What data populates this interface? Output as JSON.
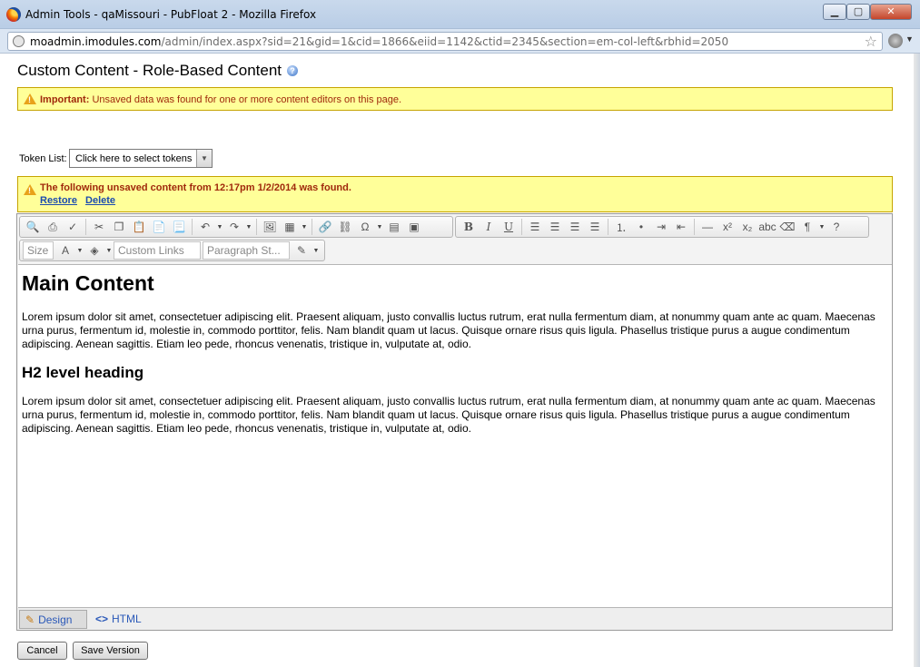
{
  "window": {
    "title": "Admin Tools - qaMissouri - PubFloat 2 - Mozilla Firefox",
    "min_label": "▁",
    "max_label": "▢",
    "close_label": "✕"
  },
  "browser": {
    "url_host": "moadmin.imodules.com",
    "url_path": "/admin/index.aspx?sid=21&gid=1&cid=1866&eiid=1142&ctid=2345&section=em-col-left&rbhid=2050"
  },
  "page": {
    "title": "Custom Content - Role-Based Content",
    "help_label": "?"
  },
  "alert_unsaved": {
    "prefix": "Important:",
    "message": "Unsaved data was found for one or more content editors on this page."
  },
  "token_list": {
    "label": "Token List:",
    "value": "Click here to select tokens"
  },
  "alert_restore": {
    "message": "The following unsaved content from 12:17pm 1/2/2014 was found.",
    "restore_label": "Restore",
    "delete_label": "Delete"
  },
  "toolbar": {
    "size_label": "Size",
    "custom_links_label": "Custom Links",
    "paragraph_label": "Paragraph St...",
    "bold": "B",
    "italic": "I",
    "underline": "U",
    "omega": "Ω"
  },
  "content": {
    "heading1": "Main Content",
    "paragraph1": "Lorem ipsum dolor sit amet, consectetuer adipiscing elit. Praesent aliquam, justo convallis luctus rutrum, erat nulla fermentum diam, at nonummy quam ante ac quam. Maecenas urna purus, fermentum id, molestie in, commodo porttitor, felis. Nam blandit quam ut lacus. Quisque ornare risus quis ligula. Phasellus tristique purus a augue condimentum adipiscing. Aenean sagittis. Etiam leo pede, rhoncus venenatis, tristique in, vulputate at, odio.",
    "heading2": "H2 level heading",
    "paragraph2": "Lorem ipsum dolor sit amet, consectetuer adipiscing elit. Praesent aliquam, justo convallis luctus rutrum, erat nulla fermentum diam, at nonummy quam ante ac quam. Maecenas urna purus, fermentum id, molestie in, commodo porttitor, felis. Nam blandit quam ut lacus. Quisque ornare risus quis ligula. Phasellus tristique purus a augue condimentum adipiscing. Aenean sagittis. Etiam leo pede, rhoncus venenatis, tristique in, vulputate at, odio."
  },
  "modes": {
    "design_label": "Design",
    "html_label": "HTML"
  },
  "buttons": {
    "cancel_label": "Cancel",
    "save_label": "Save Version"
  },
  "colors": {
    "alert_bg": "#ffff99",
    "alert_text": "#a0290c",
    "link": "#1a4bb0"
  }
}
